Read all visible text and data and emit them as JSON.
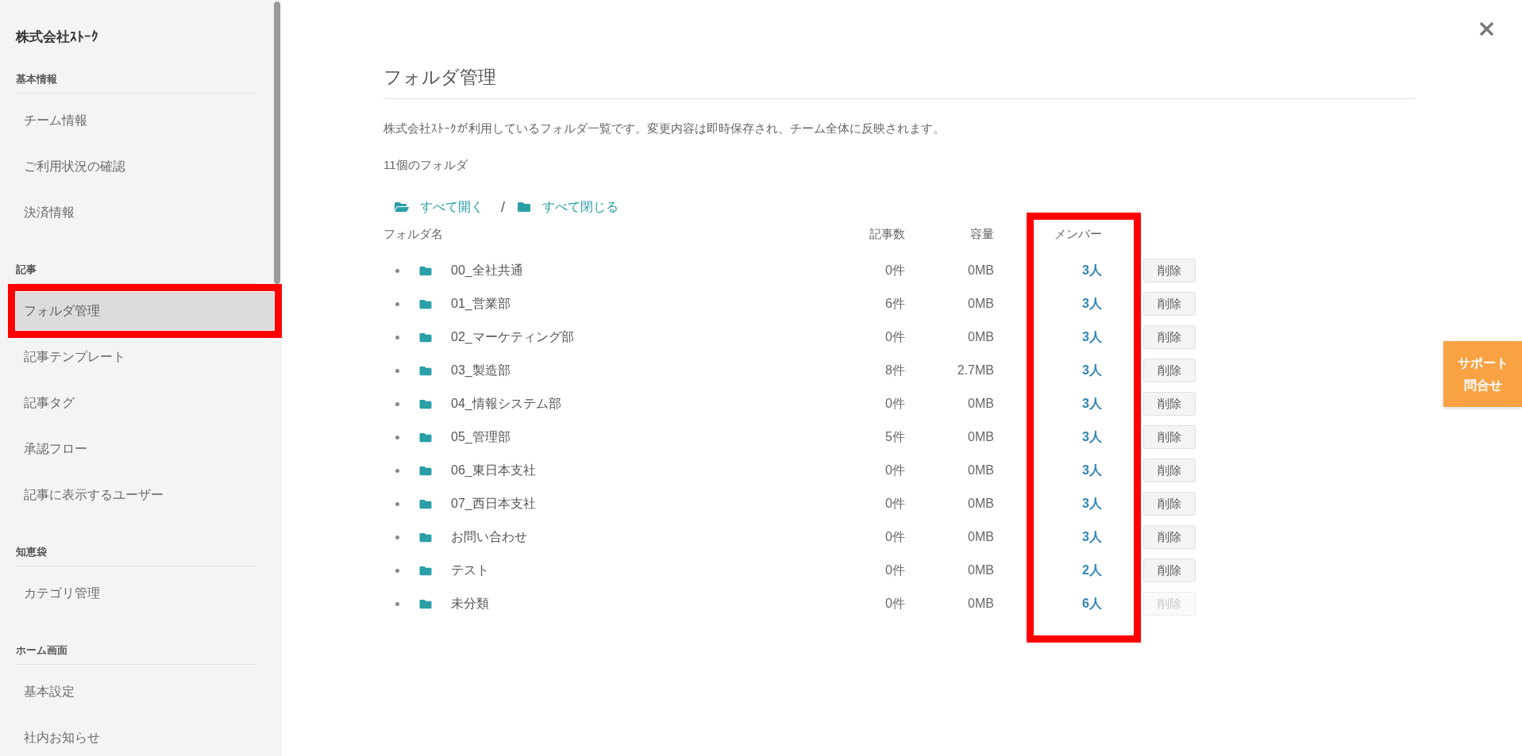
{
  "sidebar": {
    "company": "株式会社ｽﾄｰｸ",
    "sections": [
      {
        "heading": "基本情報",
        "items": [
          {
            "label": "チーム情報",
            "selected": false,
            "annotated": false
          },
          {
            "label": "ご利用状況の確認",
            "selected": false,
            "annotated": false
          },
          {
            "label": "決済情報",
            "selected": false,
            "annotated": false
          }
        ]
      },
      {
        "heading": "記事",
        "items": [
          {
            "label": "フォルダ管理",
            "selected": true,
            "annotated": true
          },
          {
            "label": "記事テンプレート",
            "selected": false,
            "annotated": false
          },
          {
            "label": "記事タグ",
            "selected": false,
            "annotated": false
          },
          {
            "label": "承認フロー",
            "selected": false,
            "annotated": false
          },
          {
            "label": "記事に表示するユーザー",
            "selected": false,
            "annotated": false
          }
        ]
      },
      {
        "heading": "知恵袋",
        "items": [
          {
            "label": "カテゴリ管理",
            "selected": false,
            "annotated": false
          }
        ]
      },
      {
        "heading": "ホーム画面",
        "items": [
          {
            "label": "基本設定",
            "selected": false,
            "annotated": false
          },
          {
            "label": "社内お知らせ",
            "selected": false,
            "annotated": false
          }
        ]
      }
    ]
  },
  "page": {
    "title": "フォルダ管理",
    "description": "株式会社ｽﾄｰｸが利用しているフォルダ一覧です。変更内容は即時保存され、チーム全体に反映されます。",
    "folder_count": "11個のフォルダ",
    "actions": [
      {
        "kind": "expand",
        "label": "すべて開く"
      },
      {
        "kind": "collapse",
        "label": "すべて閉じる"
      }
    ],
    "action_separator": "/",
    "table": {
      "columns": [
        {
          "label": "フォルダ名",
          "annotated": false
        },
        {
          "label": "記事数",
          "annotated": false
        },
        {
          "label": "容量",
          "annotated": false
        },
        {
          "label": "メンバー",
          "annotated": true
        }
      ],
      "rows": [
        {
          "name": "00_全社共通",
          "articles": "0件",
          "size": "0MB",
          "members": "3人",
          "delete": {
            "label": "削除",
            "disabled": false
          }
        },
        {
          "name": "01_営業部",
          "articles": "6件",
          "size": "0MB",
          "members": "3人",
          "delete": {
            "label": "削除",
            "disabled": false
          }
        },
        {
          "name": "02_マーケティング部",
          "articles": "0件",
          "size": "0MB",
          "members": "3人",
          "delete": {
            "label": "削除",
            "disabled": false
          }
        },
        {
          "name": "03_製造部",
          "articles": "8件",
          "size": "2.7MB",
          "members": "3人",
          "delete": {
            "label": "削除",
            "disabled": false
          }
        },
        {
          "name": "04_情報システム部",
          "articles": "0件",
          "size": "0MB",
          "members": "3人",
          "delete": {
            "label": "削除",
            "disabled": false
          }
        },
        {
          "name": "05_管理部",
          "articles": "5件",
          "size": "0MB",
          "members": "3人",
          "delete": {
            "label": "削除",
            "disabled": false
          }
        },
        {
          "name": "06_東日本支社",
          "articles": "0件",
          "size": "0MB",
          "members": "3人",
          "delete": {
            "label": "削除",
            "disabled": false
          }
        },
        {
          "name": "07_西日本支社",
          "articles": "0件",
          "size": "0MB",
          "members": "3人",
          "delete": {
            "label": "削除",
            "disabled": false
          }
        },
        {
          "name": "お問い合わせ",
          "articles": "0件",
          "size": "0MB",
          "members": "3人",
          "delete": {
            "label": "削除",
            "disabled": false
          }
        },
        {
          "name": "テスト",
          "articles": "0件",
          "size": "0MB",
          "members": "2人",
          "delete": {
            "label": "削除",
            "disabled": false
          }
        },
        {
          "name": "未分類",
          "articles": "0件",
          "size": "0MB",
          "members": "6人",
          "delete": {
            "label": "削除",
            "disabled": true
          }
        }
      ]
    }
  },
  "support_button": {
    "lines": [
      "サポート",
      "問合せ"
    ]
  }
}
